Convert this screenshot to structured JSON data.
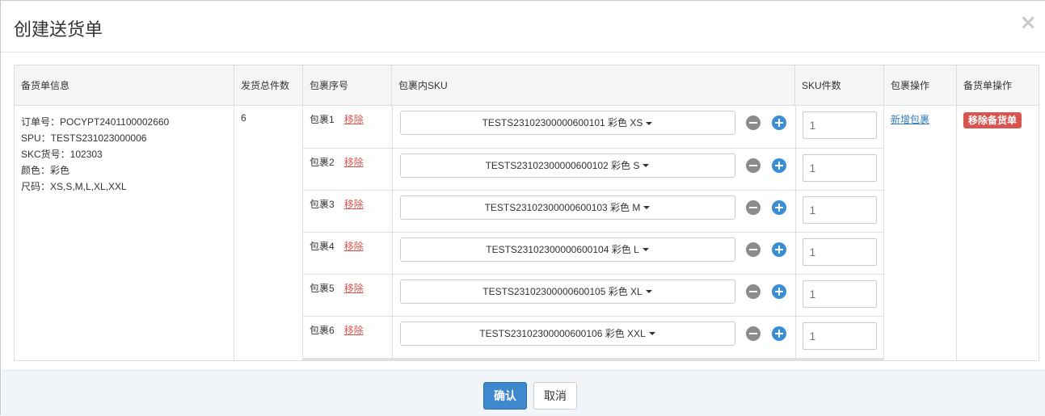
{
  "modal": {
    "title": "创建送货单",
    "close_glyph": "×"
  },
  "table": {
    "headers": [
      "备货单信息",
      "发货总件数",
      "包裹序号",
      "包裹内SKU",
      "SKU件数",
      "包裹操作",
      "备货单操作"
    ],
    "info": {
      "order_no": "订单号：POCYPT2401100002660",
      "spu": "SPU：TESTS231023000006",
      "skc": "SKC货号：102303",
      "color": "颜色：彩色",
      "size": "尺码：XS,S,M,L,XL,XXL"
    },
    "total_qty": "6",
    "packages": [
      {
        "label": "包裹1",
        "remove": "移除",
        "sku": "TESTS23102300000600101 彩色 XS",
        "qty_placeholder": "1"
      },
      {
        "label": "包裹2",
        "remove": "移除",
        "sku": "TESTS23102300000600102 彩色 S",
        "qty_placeholder": "1"
      },
      {
        "label": "包裹3",
        "remove": "移除",
        "sku": "TESTS23102300000600103 彩色 M",
        "qty_placeholder": "1"
      },
      {
        "label": "包裹4",
        "remove": "移除",
        "sku": "TESTS23102300000600104 彩色 L",
        "qty_placeholder": "1"
      },
      {
        "label": "包裹5",
        "remove": "移除",
        "sku": "TESTS23102300000600105 彩色 XL",
        "qty_placeholder": "1"
      },
      {
        "label": "包裹6",
        "remove": "移除",
        "sku": "TESTS23102300000600106 彩色 XXL",
        "qty_placeholder": "1"
      }
    ],
    "add_package": "新增包裹",
    "remove_order": "移除备货单"
  },
  "footer": {
    "confirm": "确认",
    "cancel": "取消"
  },
  "icons": {
    "minus": "minus-circle-icon",
    "plus": "plus-circle-icon",
    "caret": "caret-down-icon",
    "close": "close-icon"
  },
  "colors": {
    "danger": "#d9534f",
    "primary": "#3d88cf",
    "link": "#337ab7"
  }
}
